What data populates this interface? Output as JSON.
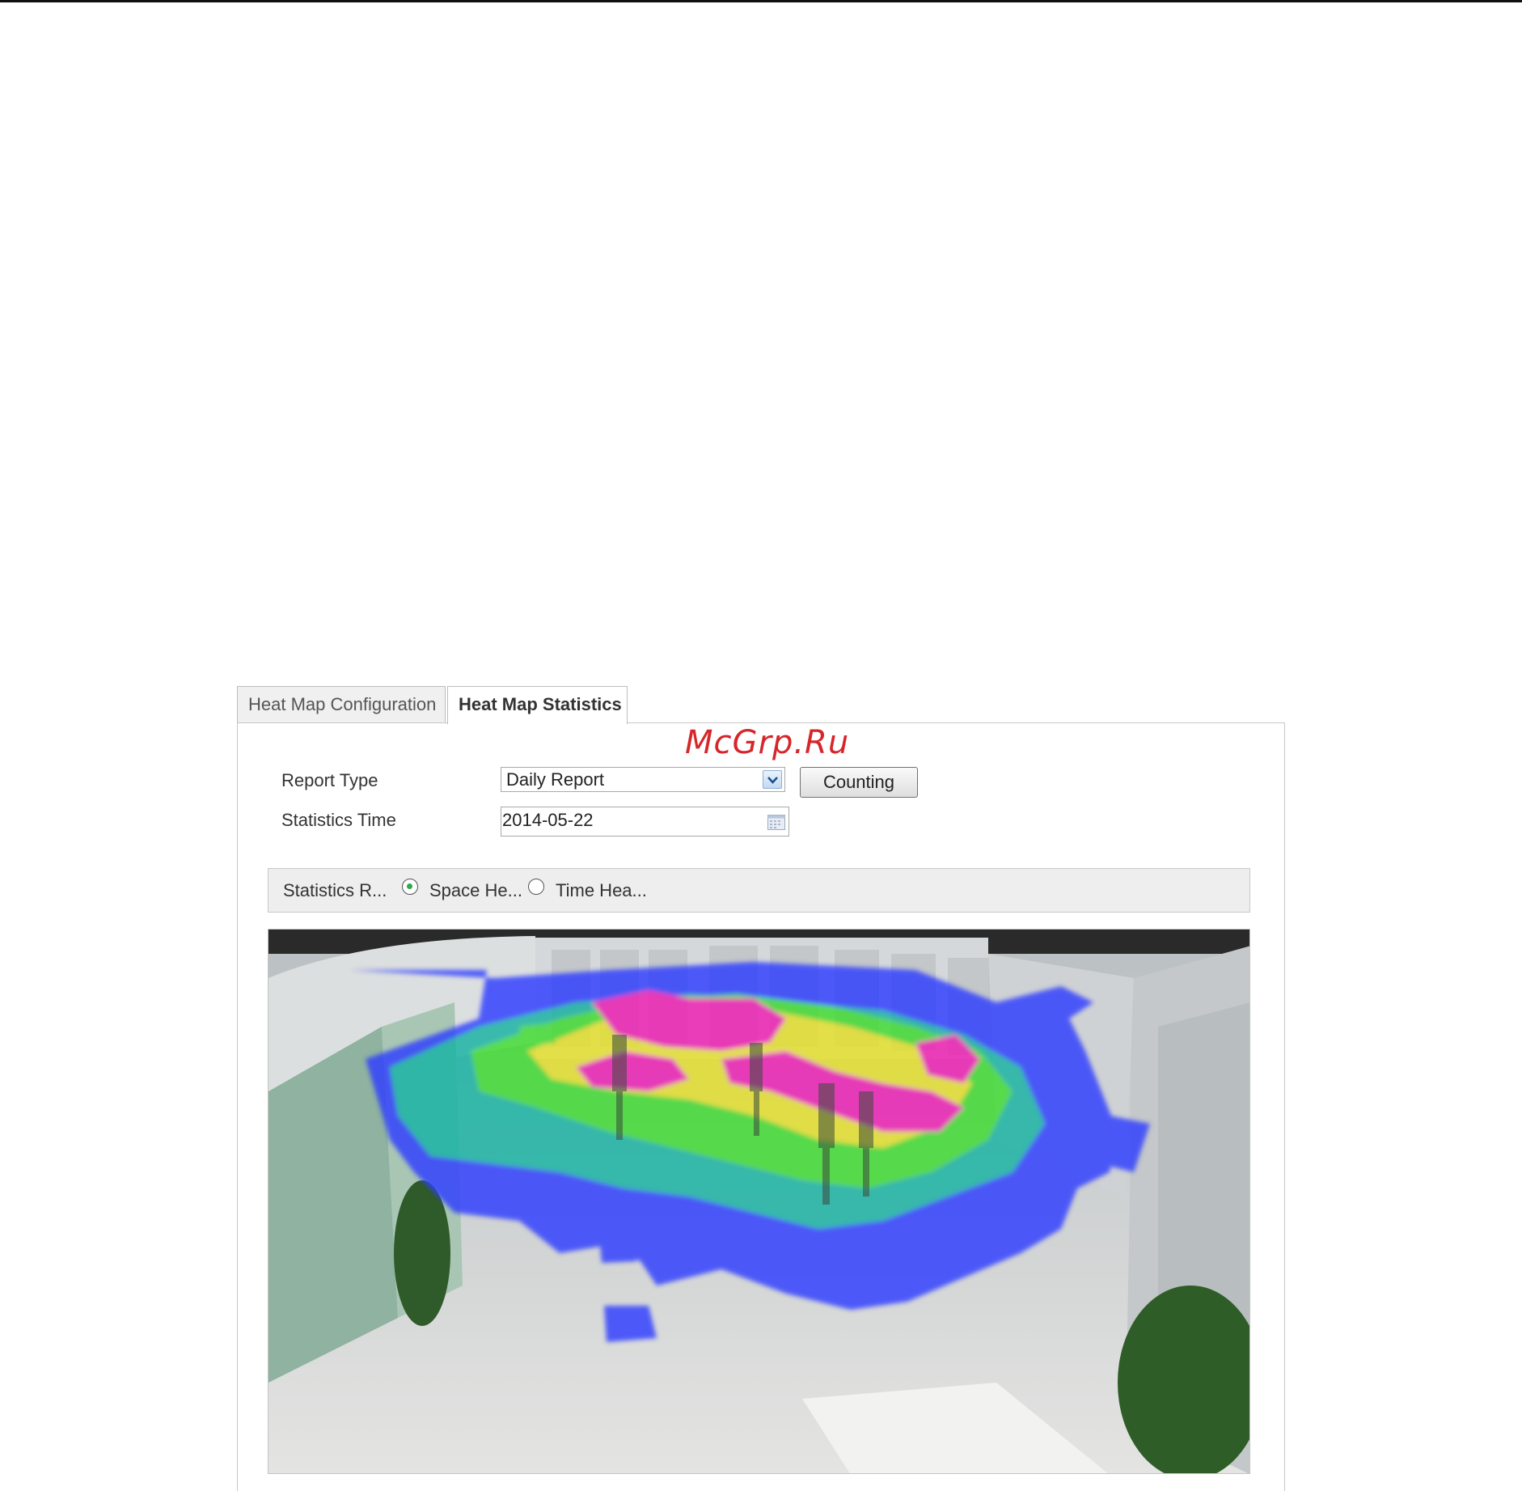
{
  "tabs": {
    "config": "Heat Map Configuration",
    "stats": "Heat Map Statistics"
  },
  "watermark": "McGrp.Ru",
  "form": {
    "report_type_label": "Report Type",
    "report_type_value": "Daily Report",
    "counting_button": "Counting",
    "statistics_time_label": "Statistics Time",
    "statistics_time_value": "2014-05-22"
  },
  "options": {
    "label": "Statistics R...",
    "space_label": "Space He...",
    "time_label": "Time Hea...",
    "selected": "space"
  },
  "icons": {
    "select_arrow": "chevron-down-icon",
    "calendar": "calendar-icon"
  },
  "colors": {
    "heat_low": "#2f3cff",
    "heat_midlow": "#19b3a3",
    "heat_mid": "#3ddc2f",
    "heat_midhigh": "#e6e12a",
    "heat_high": "#ee1fb4",
    "radio_selected": "#2fa84f",
    "watermark": "#d6262b"
  }
}
